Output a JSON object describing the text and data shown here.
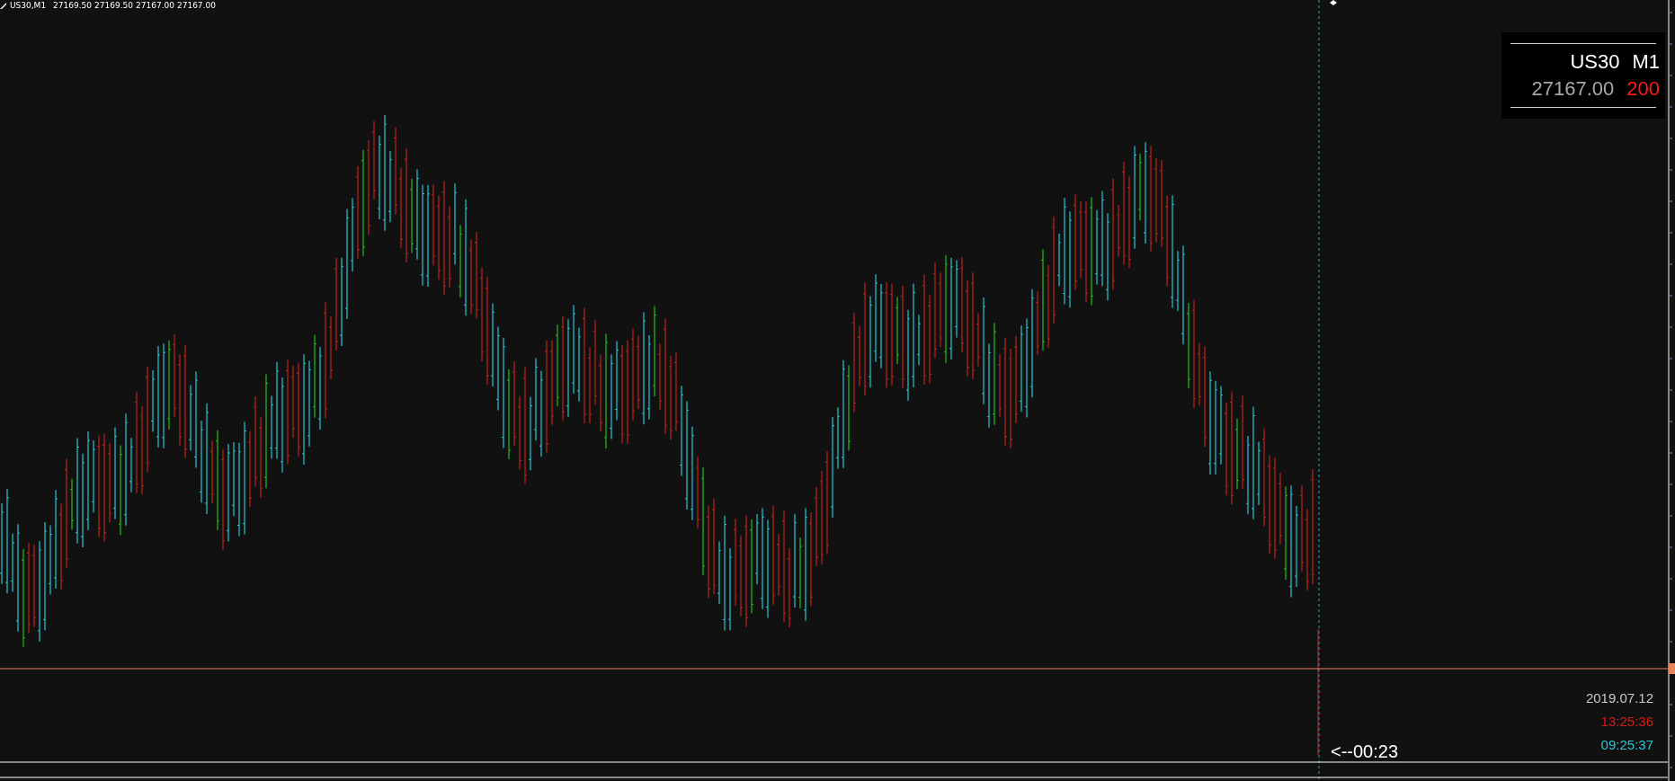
{
  "chart_header": {
    "symbol_period": "US30,M1",
    "prices": [
      "27169.50",
      "27169.50",
      "27167.00",
      "27167.00"
    ]
  },
  "info_panel": {
    "symbol": "US30",
    "timeframe": "M1",
    "price": "27167.00",
    "spread": "200"
  },
  "time_labels": {
    "date": "2019.07.12",
    "server_time": "13:25:36",
    "local_time": "09:25:37",
    "countdown": "<--00:23"
  }
}
